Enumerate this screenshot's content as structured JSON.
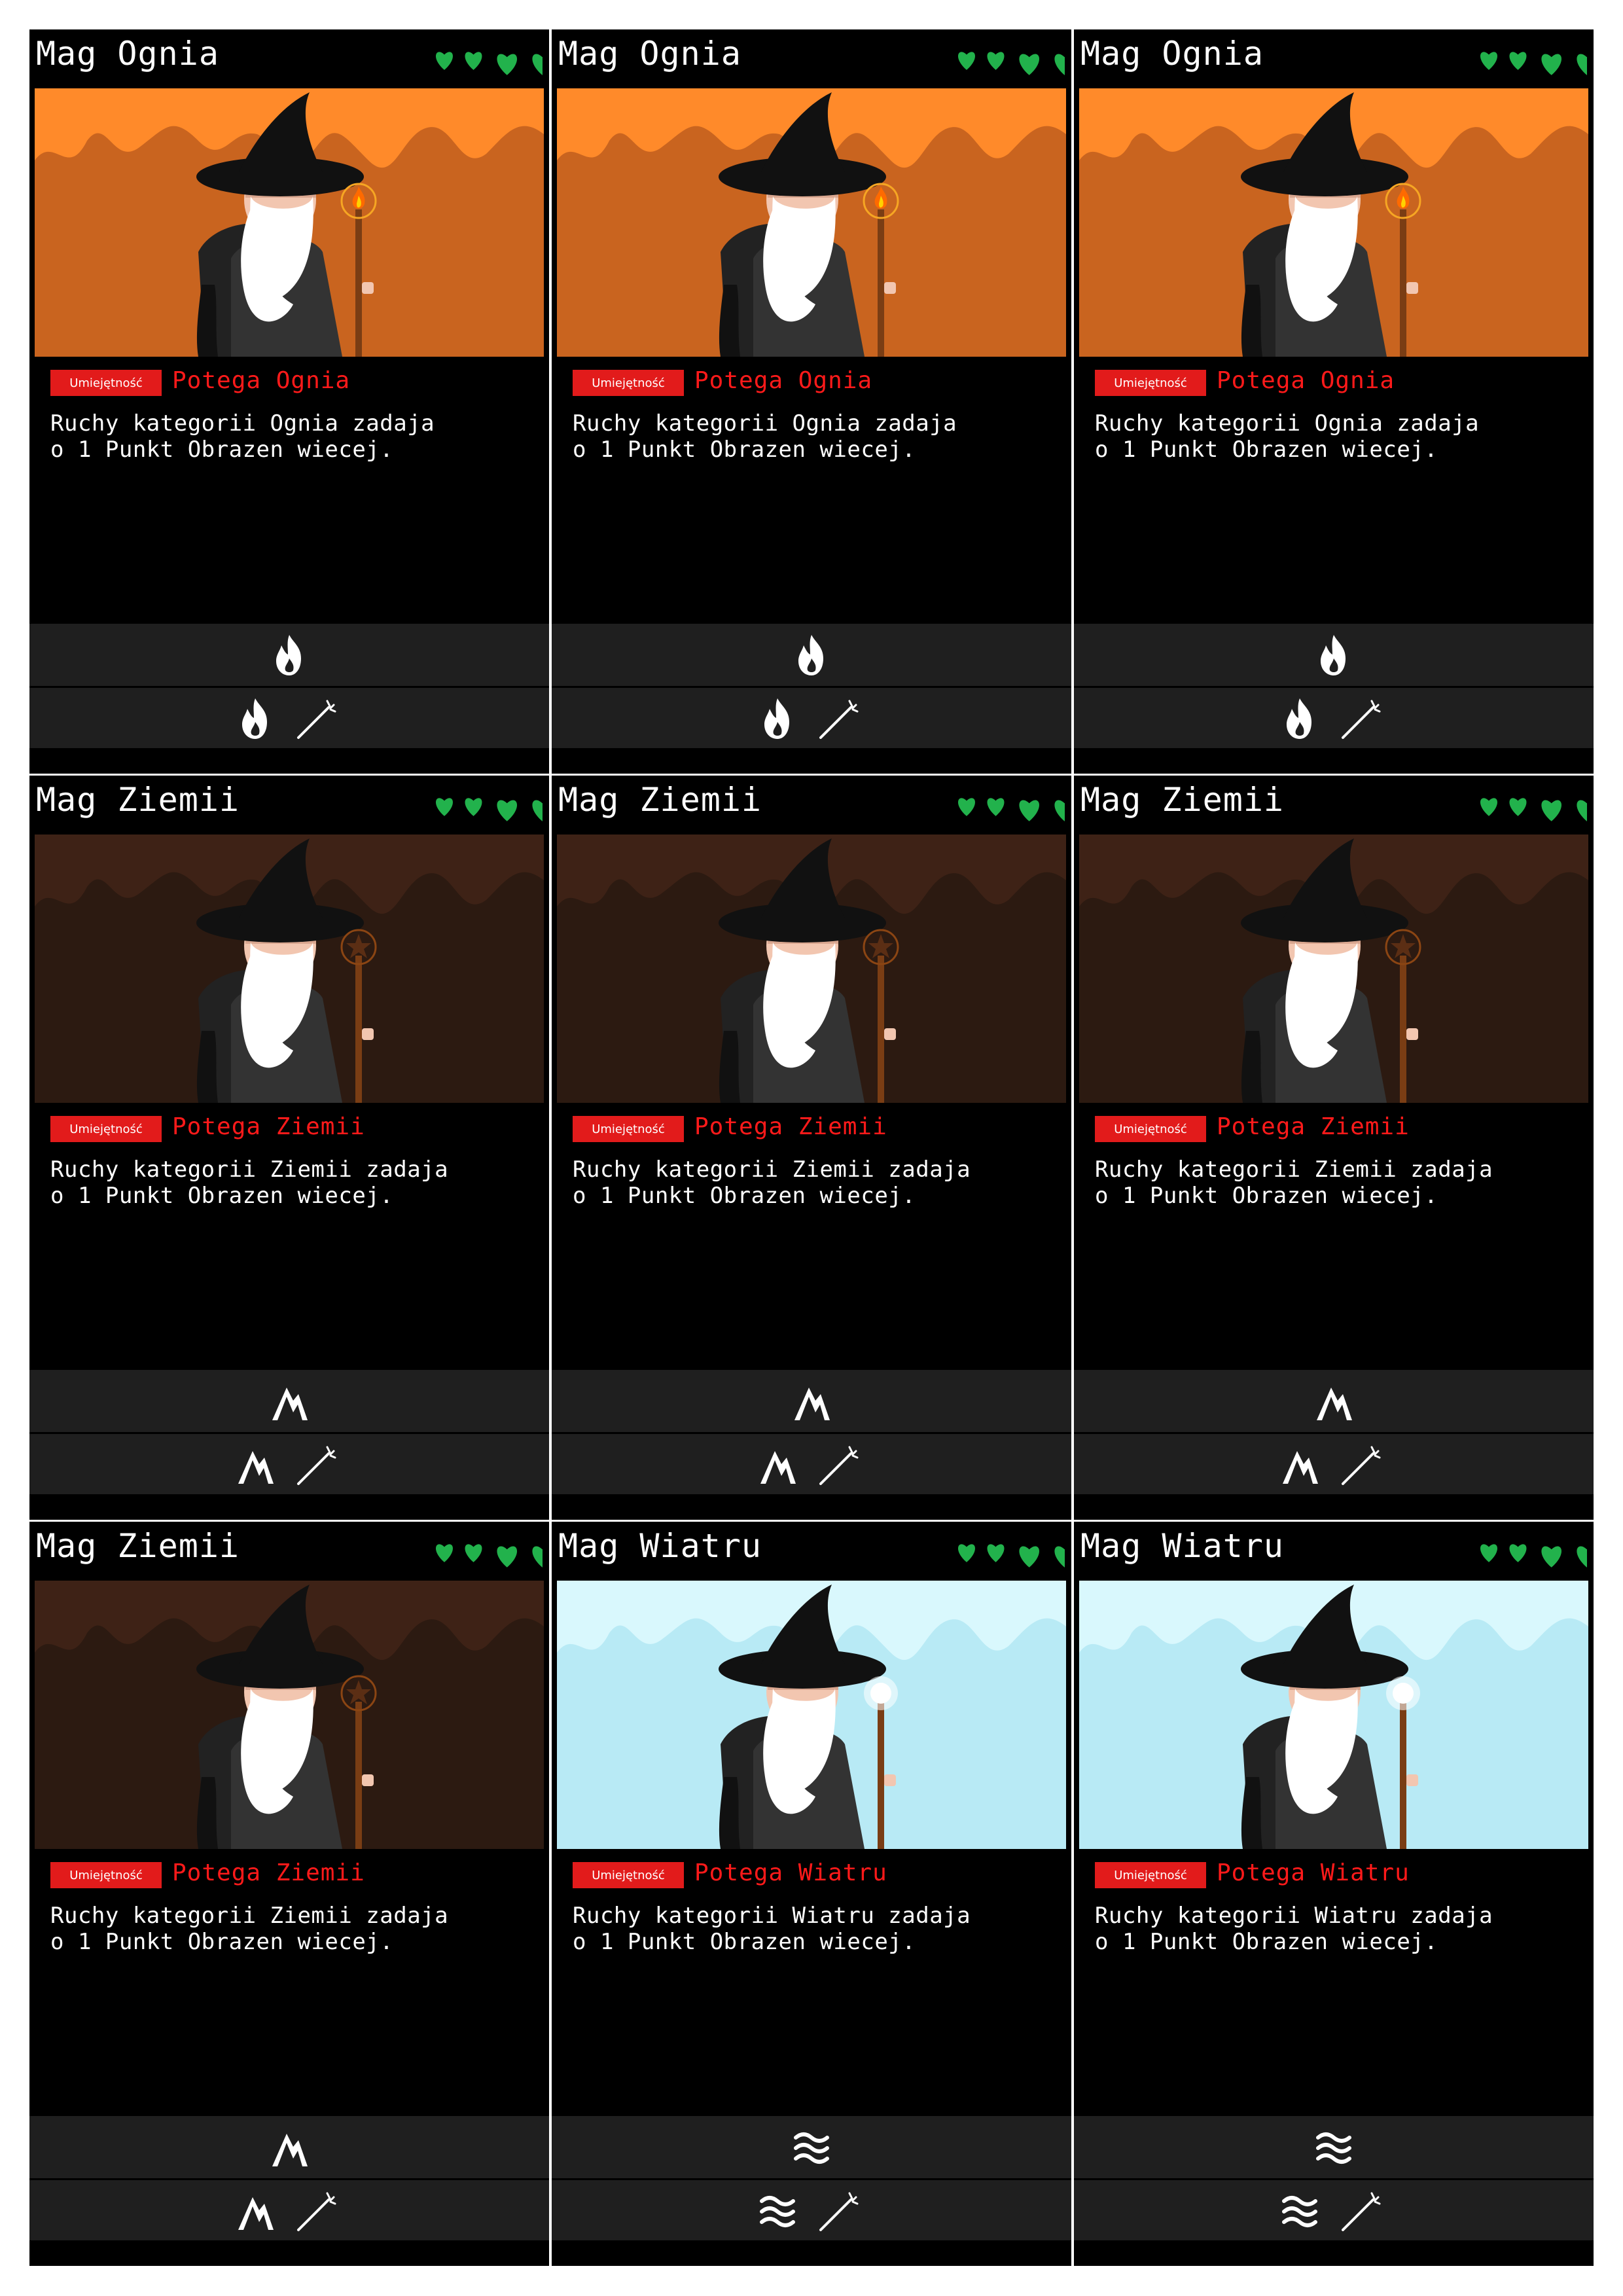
{
  "ability_badge_label": "Umiejętność",
  "colors": {
    "card_bg": "#000000",
    "panel_bg": "#1f1f1f",
    "badge_red": "#e21b1b",
    "ability_text_red": "#ff1a1a",
    "heart_green": "#22b24c"
  },
  "themes": {
    "fire": {
      "sky": "#ff8a2a",
      "mountain": "#c9641f",
      "staff_icon": "flame-orb",
      "element_icon": "flame-icon"
    },
    "earth": {
      "sky": "#3e2216",
      "mountain": "#2c1a11",
      "staff_icon": "star-orb",
      "element_icon": "mountain-icon"
    },
    "wind": {
      "sky": "#d9f8fd",
      "mountain": "#b8eaf5",
      "staff_icon": "glow-orb",
      "element_icon": "wind-icon"
    }
  },
  "cards": [
    {
      "title": "Mag Ognia",
      "theme": "fire",
      "hearts": 4,
      "ability_name": "Potega Ognia",
      "description": [
        "Ruchy kategorii Ognia zadaja",
        "o 1 Punkt Obrazen wiecej."
      ]
    },
    {
      "title": "Mag Ognia",
      "theme": "fire",
      "hearts": 4,
      "ability_name": "Potega Ognia",
      "description": [
        "Ruchy kategorii Ognia zadaja",
        "o 1 Punkt Obrazen wiecej."
      ]
    },
    {
      "title": "Mag Ognia",
      "theme": "fire",
      "hearts": 4,
      "ability_name": "Potega Ognia",
      "description": [
        "Ruchy kategorii Ognia zadaja",
        "o 1 Punkt Obrazen wiecej."
      ]
    },
    {
      "title": "Mag Ziemii",
      "theme": "earth",
      "hearts": 4,
      "ability_name": "Potega Ziemii",
      "description": [
        "Ruchy kategorii Ziemii zadaja",
        "o 1 Punkt Obrazen wiecej."
      ]
    },
    {
      "title": "Mag Ziemii",
      "theme": "earth",
      "hearts": 4,
      "ability_name": "Potega Ziemii",
      "description": [
        "Ruchy kategorii Ziemii zadaja",
        "o 1 Punkt Obrazen wiecej."
      ]
    },
    {
      "title": "Mag Ziemii",
      "theme": "earth",
      "hearts": 4,
      "ability_name": "Potega Ziemii",
      "description": [
        "Ruchy kategorii Ziemii zadaja",
        "o 1 Punkt Obrazen wiecej."
      ]
    },
    {
      "title": "Mag Ziemii",
      "theme": "earth",
      "hearts": 4,
      "ability_name": "Potega Ziemii",
      "description": [
        "Ruchy kategorii Ziemii zadaja",
        "o 1 Punkt Obrazen wiecej."
      ]
    },
    {
      "title": "Mag Wiatru",
      "theme": "wind",
      "hearts": 4,
      "ability_name": "Potega Wiatru",
      "description": [
        "Ruchy kategorii Wiatru zadaja",
        "o 1 Punkt Obrazen wiecej."
      ]
    },
    {
      "title": "Mag Wiatru",
      "theme": "wind",
      "hearts": 4,
      "ability_name": "Potega Wiatru",
      "description": [
        "Ruchy kategorii Wiatru zadaja",
        "o 1 Punkt Obrazen wiecej."
      ]
    }
  ]
}
